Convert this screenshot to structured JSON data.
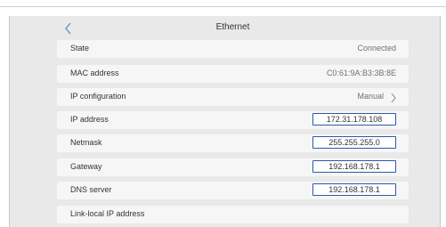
{
  "header": {
    "title": "Ethernet"
  },
  "rows": [
    {
      "label": "State",
      "value": "Connected"
    },
    {
      "label": "MAC address",
      "value": "C0:61:9A:B3:3B:8E"
    },
    {
      "label": "IP configuration",
      "value": "Manual"
    },
    {
      "label": "IP address",
      "value": "172.31.178.108"
    },
    {
      "label": "Netmask",
      "value": "255.255.255.0"
    },
    {
      "label": "Gateway",
      "value": "192.168.178.1"
    },
    {
      "label": "DNS server",
      "value": "192.168.178.1"
    },
    {
      "label": "Link-local IP address",
      "value": ""
    }
  ],
  "colors": {
    "field_border": "#2c5aa6",
    "row_bg": "#f6f6f6",
    "frame_bg": "#e9e9e9",
    "chevron": "#5a8bd6"
  },
  "icons": {
    "back": "chevron-left-icon",
    "config_arrow": "chevron-right-icon"
  }
}
